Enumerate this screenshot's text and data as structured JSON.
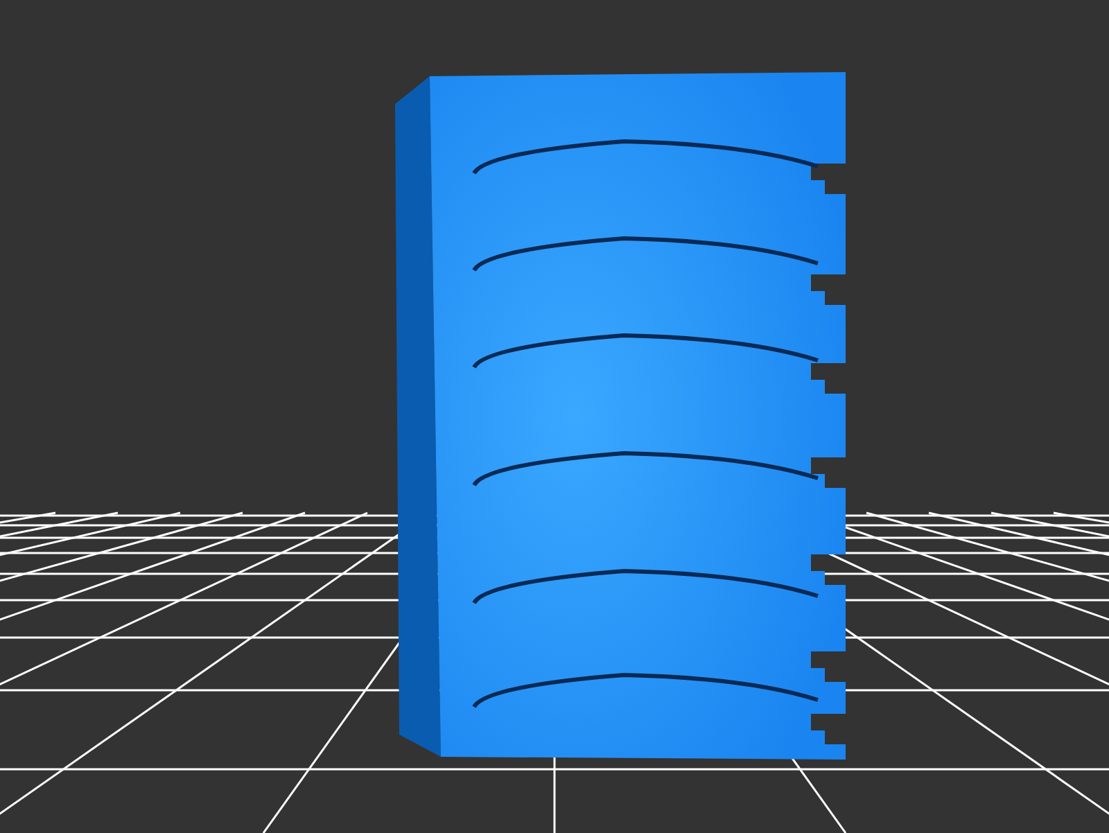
{
  "viewport": {
    "floor_grid": true
  }
}
